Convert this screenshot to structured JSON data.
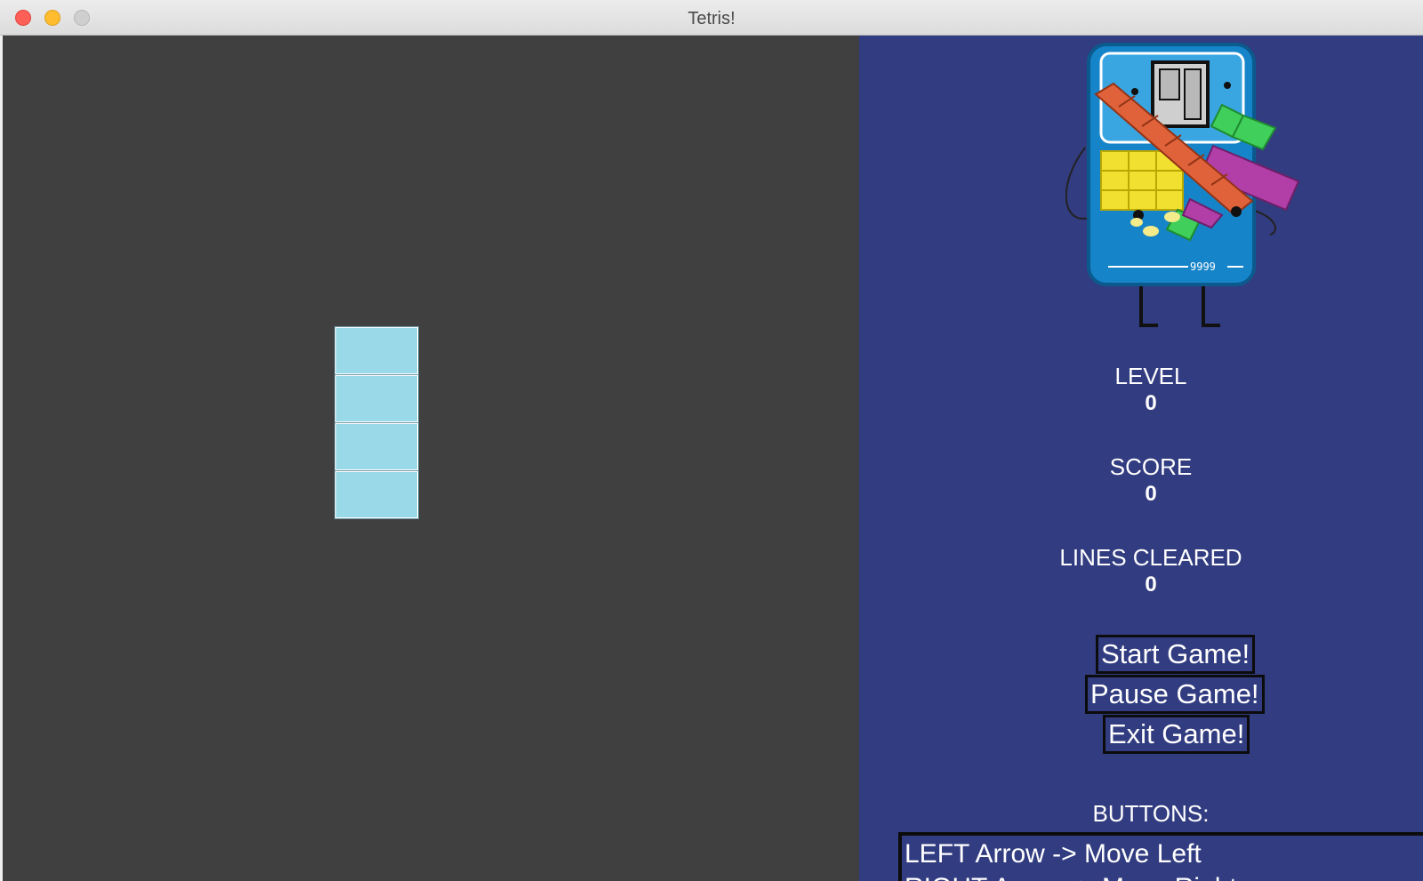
{
  "window": {
    "title": "Tetris!"
  },
  "board": {
    "background": "#404040",
    "active_piece": {
      "type": "I",
      "orientation": "vertical",
      "color": "#9ad9e8",
      "cells": 4
    }
  },
  "panel": {
    "background": "#323c80",
    "mascot": {
      "description_icon": "tetris-console-mascot-icon",
      "screen_score": "9999"
    },
    "stats": [
      {
        "label": "LEVEL",
        "value": "0"
      },
      {
        "label": "SCORE",
        "value": "0"
      },
      {
        "label": "LINES CLEARED",
        "value": "0"
      }
    ],
    "buttons": {
      "start": "Start Game!",
      "pause": "Pause Game!",
      "exit": "Exit Game!"
    },
    "controls": {
      "title": "BUTTONS:",
      "lines": [
        "LEFT Arrow -> Move Left",
        "RIGHT Arrow -> Move Right"
      ]
    }
  }
}
